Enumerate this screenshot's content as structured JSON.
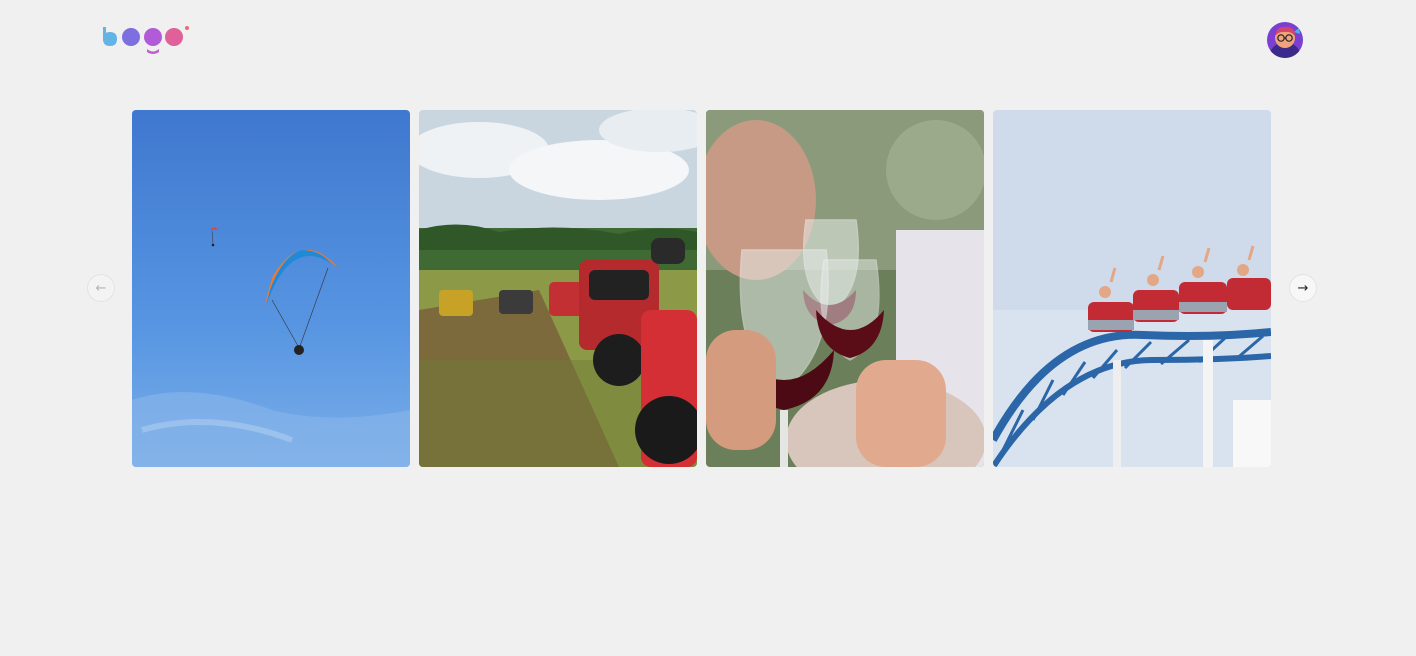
{
  "header": {
    "logo": {
      "text": "logo",
      "icon": "logo-mark"
    },
    "avatar": {
      "icon": "user-avatar"
    }
  },
  "carousel": {
    "prev_button": {
      "icon": "arrow-left-icon",
      "glyph": "←",
      "enabled": false
    },
    "next_button": {
      "icon": "arrow-right-icon",
      "glyph": "→",
      "enabled": true
    },
    "cards": [
      {
        "image": "paragliding-blue-sky"
      },
      {
        "image": "atv-quad-bikes-field"
      },
      {
        "image": "red-wine-glasses-toast"
      },
      {
        "image": "roller-coaster-blue-track"
      }
    ]
  },
  "colors": {
    "background": "#f0f0f0",
    "logo_blue": "#5aa7e0",
    "logo_purple": "#8a5cd8",
    "logo_pink": "#e0609a"
  }
}
